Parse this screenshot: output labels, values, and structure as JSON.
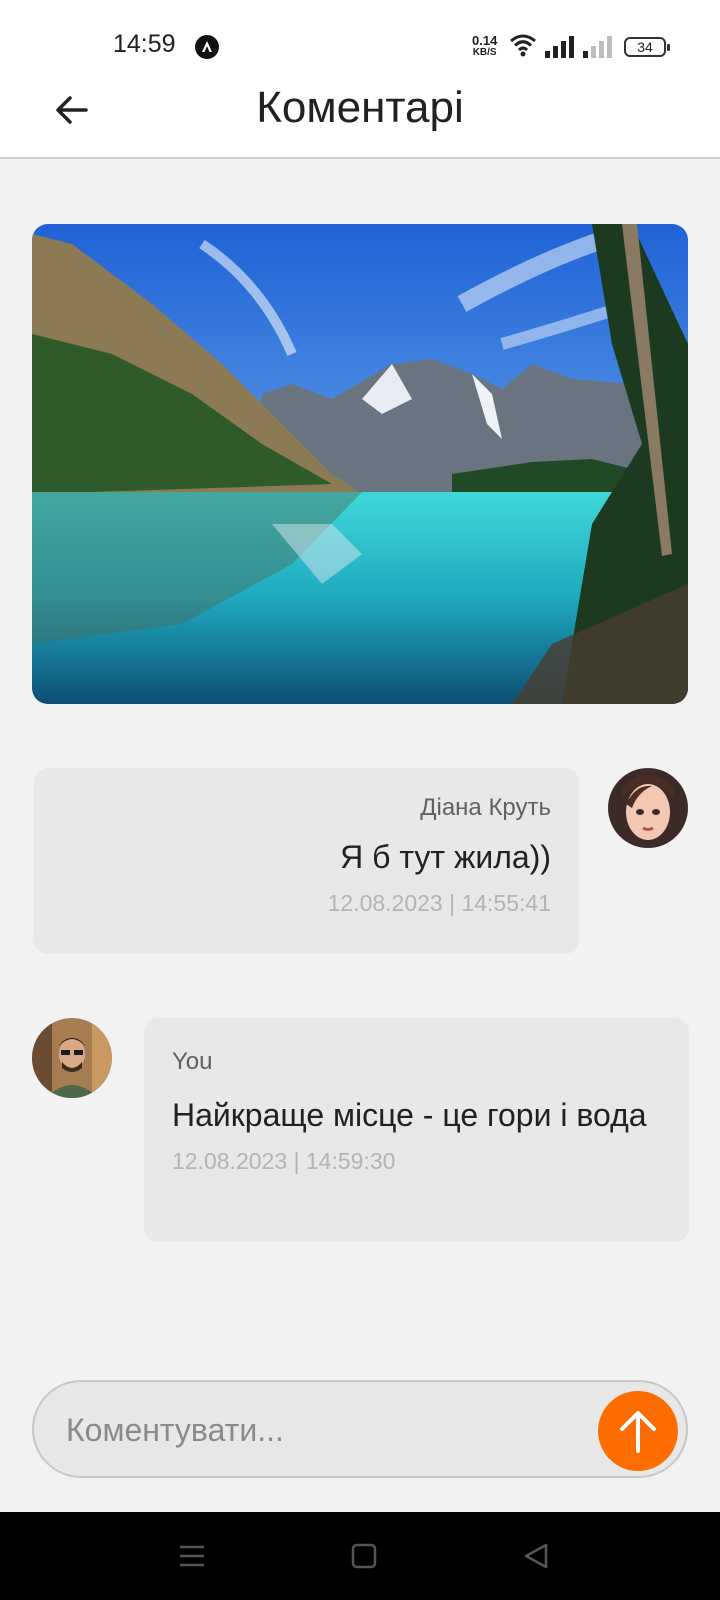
{
  "status_bar": {
    "time": "14:59",
    "net_speed_value": "0.14",
    "net_speed_unit": "KB/S",
    "battery": "34"
  },
  "header": {
    "title": "Коментарі"
  },
  "comments": [
    {
      "author": "Діана Круть",
      "text": "Я б тут жила))",
      "timestamp": "12.08.2023 | 14:55:41"
    },
    {
      "author": "You",
      "text": "Найкраще місце - це гори і вода",
      "timestamp": "12.08.2023 | 14:59:30"
    }
  ],
  "composer": {
    "placeholder": "Коментувати..."
  },
  "colors": {
    "accent": "#ff6d00",
    "bubble": "#e8e8e8",
    "background": "#f2f2f2"
  },
  "icons": {
    "back": "arrow-left-icon",
    "send": "arrow-up-icon",
    "nav_menu": "menu-icon",
    "nav_home": "square-icon",
    "nav_back": "triangle-back-icon"
  }
}
